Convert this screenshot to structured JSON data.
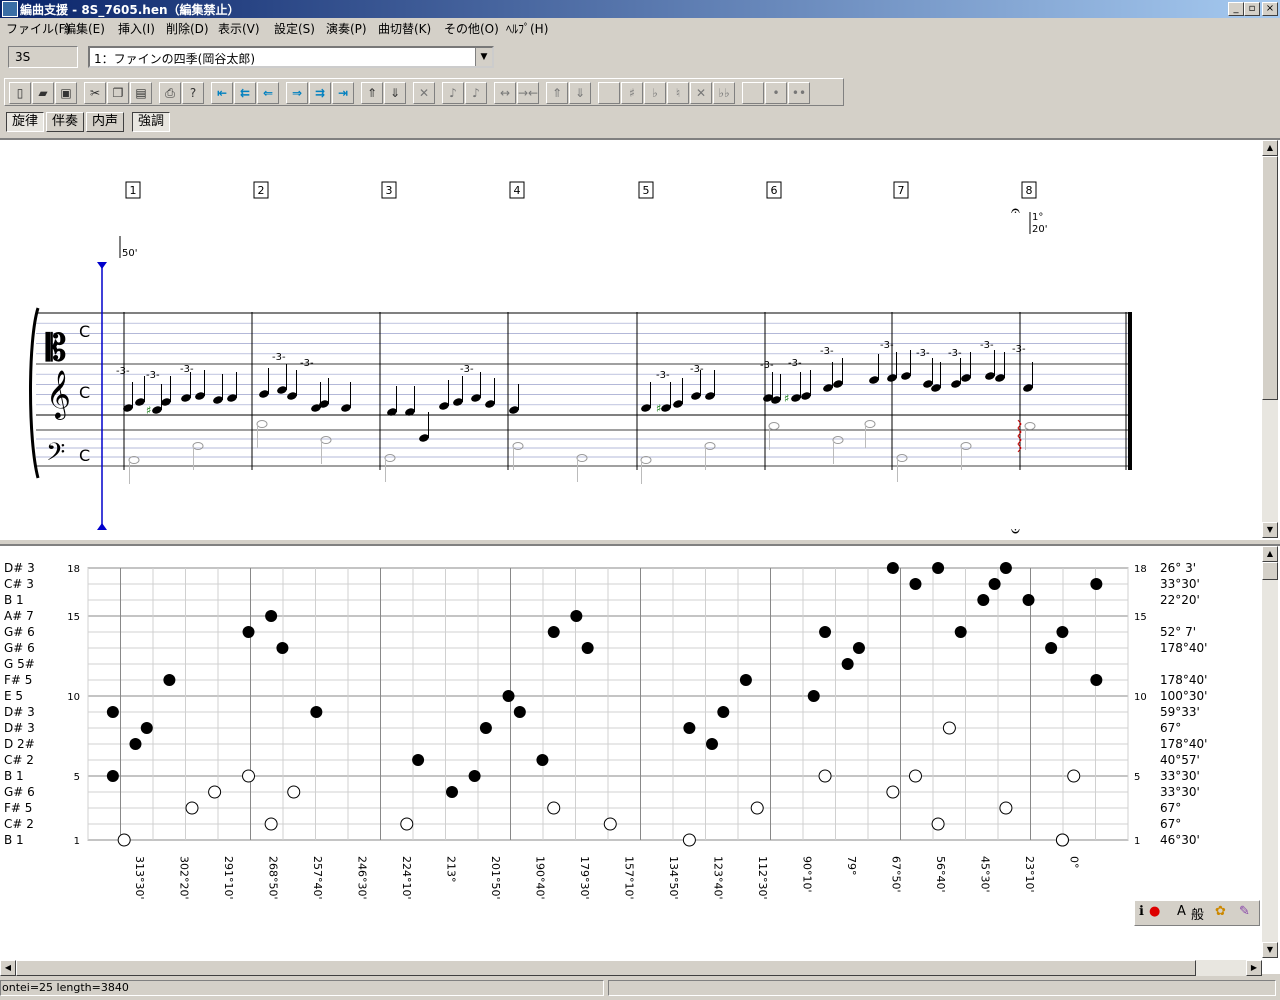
{
  "window": {
    "title": "編曲支援 - 8S_7605.hen（編集禁止）",
    "minimize": "_",
    "maximize": "▫",
    "close": "×"
  },
  "menu": [
    "ファイル(F)",
    "編集(E)",
    "挿入(I)",
    "削除(D)",
    "表示(V)",
    "設定(S)",
    "演奏(P)",
    "曲切替(K)",
    "その他(O)",
    "ﾍﾙﾌﾟ(H)"
  ],
  "part": {
    "label": "3S",
    "selected": "1：ファインの四季(岡谷太郎)"
  },
  "toolbar": [
    {
      "icon": "new-icon",
      "glyph": "▯"
    },
    {
      "icon": "open-icon",
      "glyph": "▰"
    },
    {
      "icon": "save-icon",
      "glyph": "▣"
    },
    {
      "icon": "cut-icon",
      "glyph": "✂"
    },
    {
      "icon": "copy-icon",
      "glyph": "❐"
    },
    {
      "icon": "paste-icon",
      "glyph": "▤"
    },
    {
      "icon": "print-icon",
      "glyph": "⎙"
    },
    {
      "icon": "help-icon",
      "glyph": "?"
    },
    {
      "icon": "first-icon",
      "glyph": "⇤"
    },
    {
      "icon": "rewind-icon",
      "glyph": "⇇"
    },
    {
      "icon": "prev-icon",
      "glyph": "⇐"
    },
    {
      "icon": "next-icon",
      "glyph": "⇒"
    },
    {
      "icon": "fast-forward-icon",
      "glyph": "⇉"
    },
    {
      "icon": "last-icon",
      "glyph": "⇥"
    },
    {
      "icon": "up-icon",
      "glyph": "⇑"
    },
    {
      "icon": "down-icon",
      "glyph": "⇓"
    },
    {
      "icon": "delete-icon",
      "glyph": "✕"
    },
    {
      "icon": "note-up-icon",
      "glyph": "♪"
    },
    {
      "icon": "note-down-icon",
      "glyph": "♪"
    },
    {
      "icon": "widen-icon",
      "glyph": "↔"
    },
    {
      "icon": "narrow-icon",
      "glyph": "→←"
    },
    {
      "icon": "pitch-up-icon",
      "glyph": "⇑"
    },
    {
      "icon": "pitch-down-icon",
      "glyph": "⇓"
    },
    {
      "icon": "blank-icon",
      "glyph": ""
    },
    {
      "icon": "sharp-icon",
      "glyph": "♯"
    },
    {
      "icon": "flat-icon",
      "glyph": "♭"
    },
    {
      "icon": "natural-icon",
      "glyph": "♮"
    },
    {
      "icon": "double-sharp-icon",
      "glyph": "✕"
    },
    {
      "icon": "double-flat-icon",
      "glyph": "♭♭"
    },
    {
      "icon": "blank-icon",
      "glyph": ""
    },
    {
      "icon": "dot-icon",
      "glyph": "•"
    },
    {
      "icon": "double-dot-icon",
      "glyph": "••"
    }
  ],
  "modes": [
    {
      "label": "旋律",
      "pressed": true
    },
    {
      "label": "伴奏",
      "pressed": false
    },
    {
      "label": "内声",
      "pressed": false
    },
    {
      "label": "強調",
      "pressed": true
    }
  ],
  "score": {
    "measure_numbers": [
      "1",
      "2",
      "3",
      "4",
      "5",
      "6",
      "7",
      "8"
    ],
    "time_signature": "C",
    "tuplet": "-3-",
    "tempo_mark": "50'",
    "fermata_mark_1": "1°",
    "fermata_mark_2": "20'"
  },
  "graph": {
    "y_ticks": [
      "18",
      "15",
      "10",
      "5",
      "1"
    ],
    "left_labels": [
      "D# 3",
      "C# 3",
      "B  1",
      "A# 7",
      "G# 6",
      "G# 6",
      "G  5#",
      "F# 5",
      "E  5",
      "D# 3",
      "D# 3",
      "D  2#",
      "C# 2",
      "B  1",
      "G# 6",
      "F# 5",
      "C# 2",
      "B  1"
    ],
    "right_labels": [
      "26° 3'",
      "33°30'",
      "22°20'",
      "",
      "52° 7'",
      "178°40'",
      "",
      "178°40'",
      "100°30'",
      "59°33'",
      "67°",
      "178°40'",
      "40°57'",
      "33°30'",
      "33°30'",
      "67°",
      "67°",
      "46°30'"
    ],
    "x_labels": [
      "313°30'",
      "302°20'",
      "291°10'",
      "268°50'",
      "257°40'",
      "246°30'",
      "224°10'",
      "213°",
      "201°50'",
      "190°40'",
      "179°30'",
      "157°10'",
      "134°50'",
      "123°40'",
      "112°30'",
      "90°10'",
      "79°",
      "67°50'",
      "56°40'",
      "45°30'",
      "23°10'",
      "0°"
    ],
    "filled_notes": [
      [
        1,
        5
      ],
      [
        1,
        9
      ],
      [
        3,
        7
      ],
      [
        4,
        8
      ],
      [
        6,
        11
      ],
      [
        13,
        14
      ],
      [
        15,
        15
      ],
      [
        16,
        13
      ],
      [
        19,
        9
      ],
      [
        28,
        6
      ],
      [
        31,
        4
      ],
      [
        33,
        5
      ],
      [
        34,
        8
      ],
      [
        36,
        10
      ],
      [
        37,
        9
      ],
      [
        39,
        6
      ],
      [
        40,
        14
      ],
      [
        42,
        15
      ],
      [
        43,
        13
      ],
      [
        52,
        8
      ],
      [
        54,
        7
      ],
      [
        55,
        9
      ],
      [
        57,
        11
      ],
      [
        63,
        10
      ],
      [
        64,
        14
      ],
      [
        66,
        12
      ],
      [
        67,
        13
      ],
      [
        70,
        18
      ],
      [
        72,
        17
      ],
      [
        74,
        18
      ],
      [
        76,
        14
      ],
      [
        78,
        16
      ],
      [
        79,
        17
      ],
      [
        80,
        18
      ],
      [
        82,
        16
      ],
      [
        84,
        13
      ],
      [
        85,
        14
      ],
      [
        88,
        17
      ],
      [
        88,
        11
      ]
    ],
    "open_notes": [
      [
        2,
        1
      ],
      [
        8,
        3
      ],
      [
        10,
        4
      ],
      [
        13,
        5
      ],
      [
        15,
        2
      ],
      [
        17,
        4
      ],
      [
        27,
        2
      ],
      [
        40,
        3
      ],
      [
        45,
        2
      ],
      [
        52,
        1
      ],
      [
        58,
        3
      ],
      [
        64,
        5
      ],
      [
        70,
        4
      ],
      [
        72,
        5
      ],
      [
        74,
        2
      ],
      [
        75,
        8
      ],
      [
        80,
        3
      ],
      [
        85,
        1
      ],
      [
        86,
        5
      ],
      [
        85,
        1
      ]
    ]
  },
  "status": "ontei=25 length=3840",
  "mini_toolbar": [
    "ℹ",
    "●",
    "A",
    "般",
    "✿",
    "✎"
  ]
}
